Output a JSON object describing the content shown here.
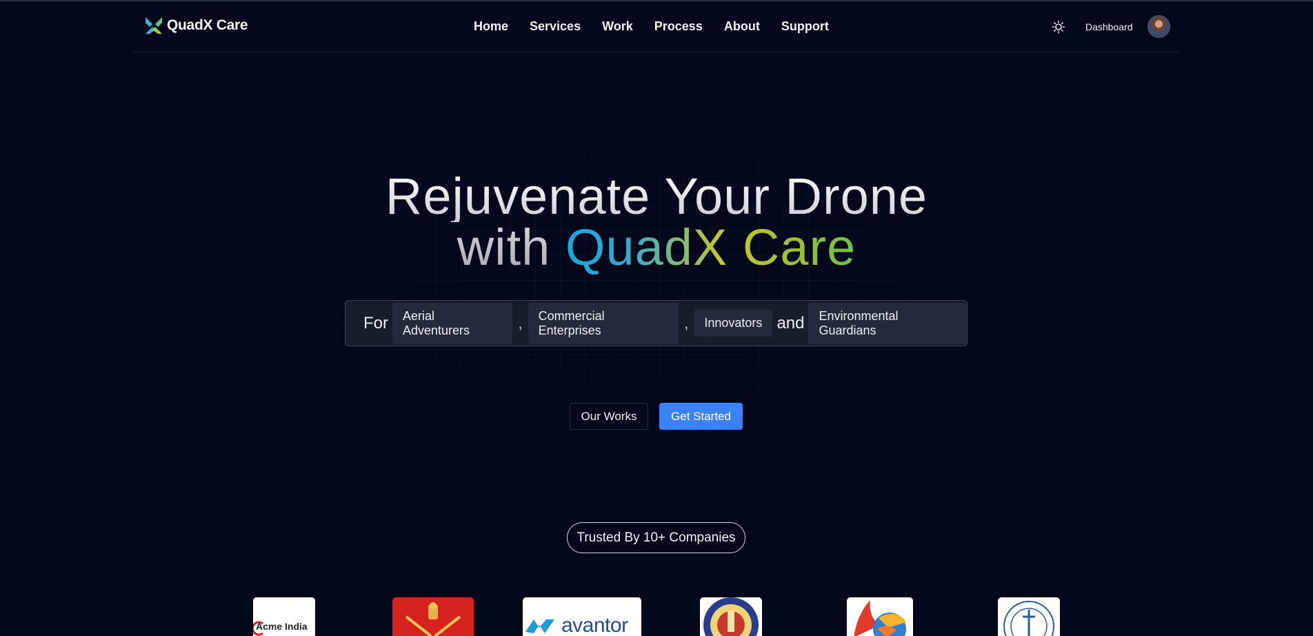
{
  "header": {
    "brand": "QuadX Care",
    "nav": [
      "Home",
      "Services",
      "Work",
      "Process",
      "About",
      "Support"
    ],
    "dashboard_label": "Dashboard"
  },
  "hero": {
    "title_line1": "Rejuvenate Your Drone",
    "title_with": "with",
    "title_brand": "QuadX Care",
    "for_label": "For",
    "audiences": [
      "Aerial Adventurers",
      "Commercial Enterprises",
      "Innovators",
      "Environmental Guardians"
    ],
    "separator": ",",
    "and_label": "and"
  },
  "actions": {
    "works_label": "Our Works",
    "start_label": "Get Started"
  },
  "trusted": {
    "label": "Trusted By 10+ Companies",
    "logos": [
      {
        "icon": "acme-india-logo",
        "text": "Acme India"
      },
      {
        "icon": "emblem-logo"
      },
      {
        "icon": "avantor-logo",
        "text": "avantor"
      },
      {
        "icon": "institute-seal-logo"
      },
      {
        "icon": "phoenix-logo"
      },
      {
        "icon": "university-seal-logo"
      }
    ]
  },
  "colors": {
    "background": "#03091b",
    "primary_button": "#3b82f6",
    "brand_gradient": [
      "#1aa6de",
      "#c9c62d",
      "#6fbf4a"
    ]
  }
}
